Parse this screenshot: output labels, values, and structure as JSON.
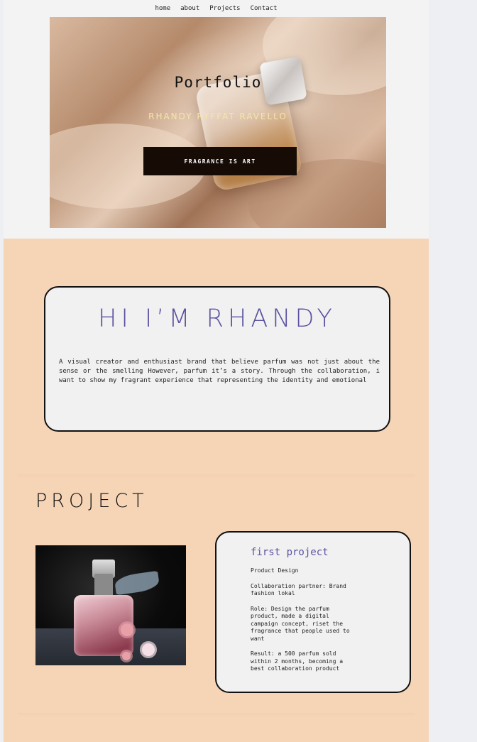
{
  "nav": {
    "items": [
      "home",
      "about",
      "Projects",
      "Contact"
    ]
  },
  "hero": {
    "title": "Portfolio",
    "name": "RHANDY RYFFAT RAVELLO",
    "button_label": "FRAGRANCE IS ART"
  },
  "about": {
    "title": "HI I’M RHANDY",
    "text": "A visual creator and enthusiast brand that believe parfum was not just about the sense or the smelling However, parfum it’s a story. Through the collaboration, i want to show my fragrant experience that representing the identity and emotional"
  },
  "projects": {
    "heading": "PROJECT",
    "first": {
      "title": "first project",
      "category": "Product Design",
      "partner": "Collaboration partner: Brand fashion lokal",
      "role": "Role: Design the parfum product, made a digital campaign concept, riset the fragrance that people used to want",
      "result": "Result: a 500 parfum sold within 2 months, becoming a best collaboration product"
    }
  },
  "colors": {
    "peach_bg": "#f6d4b6",
    "accent_purple": "#5a52a0",
    "hero_name": "#f4e6a8",
    "button_bg": "#160b05"
  }
}
